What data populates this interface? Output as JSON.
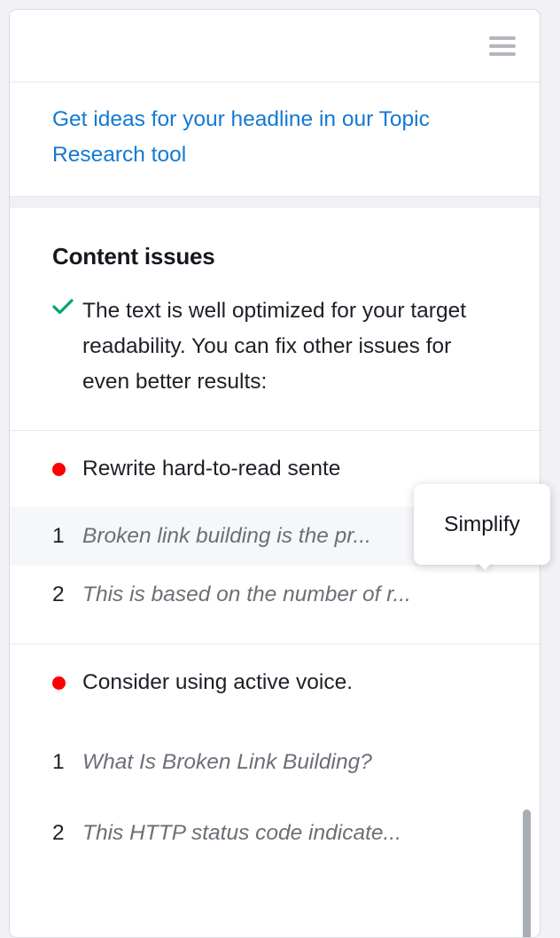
{
  "header": {
    "menu_icon": "hamburger-menu-icon"
  },
  "promo": {
    "link_text": "Get ideas for your headline in our Topic Research tool"
  },
  "content_issues": {
    "title": "Content issues",
    "note": {
      "icon": "green-check-icon",
      "text": "The text is well optimized for your target readability. You can fix other issues for even better results:"
    },
    "groups": [
      {
        "marker": "red-dot-icon",
        "label": "Rewrite hard-to-read sente",
        "sentences": [
          {
            "number": "1",
            "text": "Broken link building is the pr...",
            "action_icon": "t-shirt-simplify-icon",
            "highlighted": true
          },
          {
            "number": "2",
            "text": "This is based on the number of r...",
            "action_icon": "",
            "highlighted": false
          }
        ]
      },
      {
        "marker": "red-dot-icon",
        "label": "Consider using active voice.",
        "sentences": [
          {
            "number": "1",
            "text": "What Is Broken Link Building?",
            "action_icon": "",
            "highlighted": false
          },
          {
            "number": "2",
            "text": "This HTTP status code indicate...",
            "action_icon": "",
            "highlighted": false
          }
        ]
      }
    ]
  },
  "tooltip": {
    "label": "Simplify"
  },
  "colors": {
    "link": "#1479d1",
    "issue_dot": "#fa0000",
    "check": "#00a667",
    "panel_bg": "#ffffff",
    "page_bg": "#f1f1f6",
    "row_highlight": "#f6f7f9",
    "scrollbar_thumb": "#a9adb4"
  }
}
